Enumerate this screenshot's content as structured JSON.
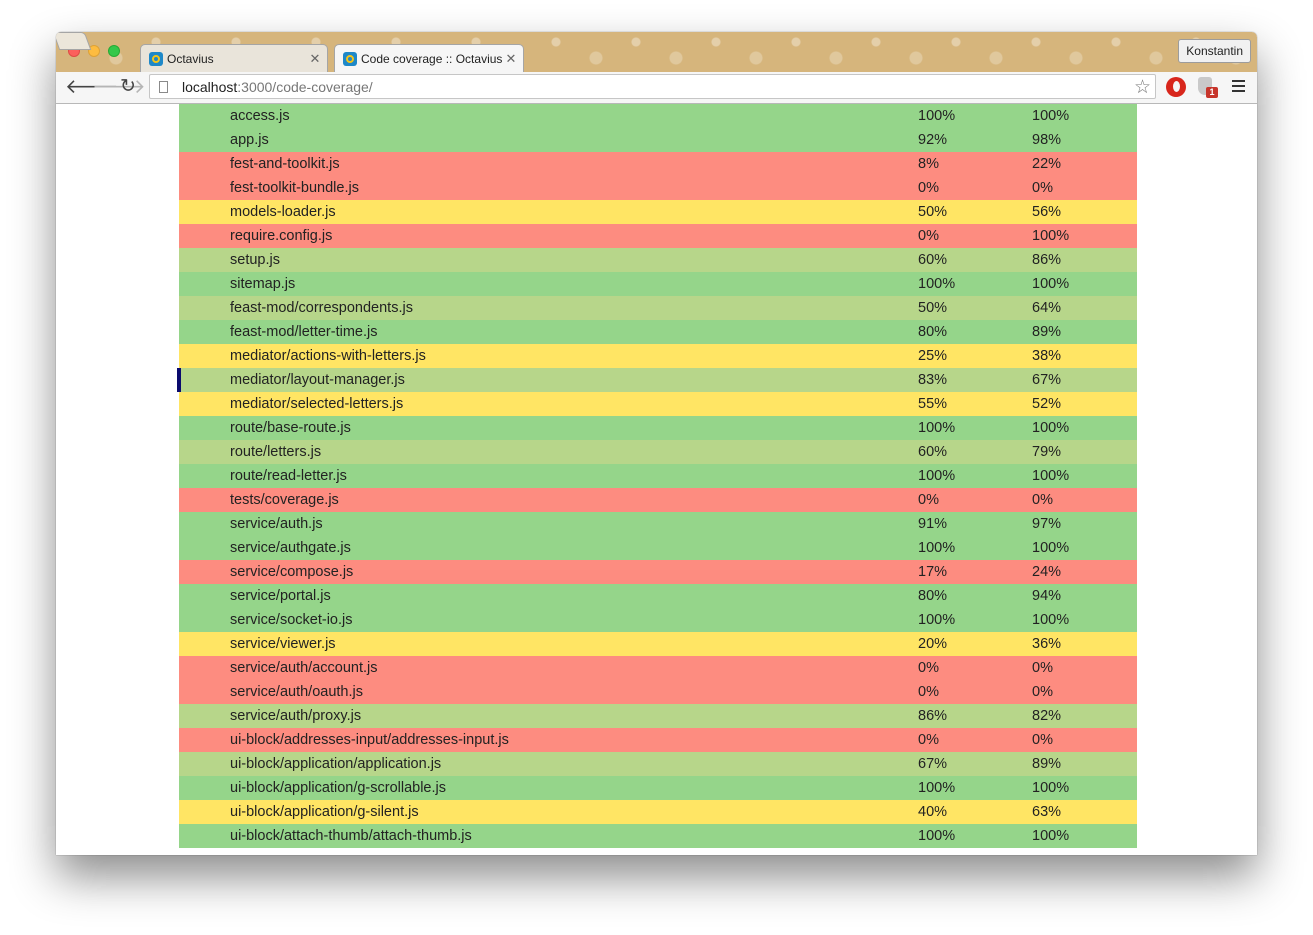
{
  "browser": {
    "tabs": [
      {
        "title": "Octavius",
        "active": false
      },
      {
        "title": "Code coverage :: Octavius",
        "active": true
      }
    ],
    "profile_name": "Konstantin",
    "url_host": "localhost",
    "url_path": ":3000/code-coverage/",
    "extension_badge": "1"
  },
  "colors": {
    "high": "#95d58a",
    "good": "#b7d68a",
    "medium": "#ffe564",
    "low": "#fd8c80"
  },
  "coverage": {
    "rows": [
      {
        "file": "access.js",
        "c1": "100%",
        "c2": "100%",
        "level": "green"
      },
      {
        "file": "app.js",
        "c1": "92%",
        "c2": "98%",
        "level": "green"
      },
      {
        "file": "fest-and-toolkit.js",
        "c1": "8%",
        "c2": "22%",
        "level": "red"
      },
      {
        "file": "fest-toolkit-bundle.js",
        "c1": "0%",
        "c2": "0%",
        "level": "red"
      },
      {
        "file": "models-loader.js",
        "c1": "50%",
        "c2": "56%",
        "level": "yellow"
      },
      {
        "file": "require.config.js",
        "c1": "0%",
        "c2": "100%",
        "level": "red"
      },
      {
        "file": "setup.js",
        "c1": "60%",
        "c2": "86%",
        "level": "lgreen"
      },
      {
        "file": "sitemap.js",
        "c1": "100%",
        "c2": "100%",
        "level": "green"
      },
      {
        "file": "feast-mod/correspondents.js",
        "c1": "50%",
        "c2": "64%",
        "level": "lgreen"
      },
      {
        "file": "feast-mod/letter-time.js",
        "c1": "80%",
        "c2": "89%",
        "level": "green"
      },
      {
        "file": "mediator/actions-with-letters.js",
        "c1": "25%",
        "c2": "38%",
        "level": "yellow"
      },
      {
        "file": "mediator/layout-manager.js",
        "c1": "83%",
        "c2": "67%",
        "level": "lgreen",
        "marked": true
      },
      {
        "file": "mediator/selected-letters.js",
        "c1": "55%",
        "c2": "52%",
        "level": "yellow"
      },
      {
        "file": "route/base-route.js",
        "c1": "100%",
        "c2": "100%",
        "level": "green"
      },
      {
        "file": "route/letters.js",
        "c1": "60%",
        "c2": "79%",
        "level": "lgreen"
      },
      {
        "file": "route/read-letter.js",
        "c1": "100%",
        "c2": "100%",
        "level": "green"
      },
      {
        "file": "tests/coverage.js",
        "c1": "0%",
        "c2": "0%",
        "level": "red"
      },
      {
        "file": "service/auth.js",
        "c1": "91%",
        "c2": "97%",
        "level": "green"
      },
      {
        "file": "service/authgate.js",
        "c1": "100%",
        "c2": "100%",
        "level": "green"
      },
      {
        "file": "service/compose.js",
        "c1": "17%",
        "c2": "24%",
        "level": "red"
      },
      {
        "file": "service/portal.js",
        "c1": "80%",
        "c2": "94%",
        "level": "green"
      },
      {
        "file": "service/socket-io.js",
        "c1": "100%",
        "c2": "100%",
        "level": "green"
      },
      {
        "file": "service/viewer.js",
        "c1": "20%",
        "c2": "36%",
        "level": "yellow"
      },
      {
        "file": "service/auth/account.js",
        "c1": "0%",
        "c2": "0%",
        "level": "red"
      },
      {
        "file": "service/auth/oauth.js",
        "c1": "0%",
        "c2": "0%",
        "level": "red"
      },
      {
        "file": "service/auth/proxy.js",
        "c1": "86%",
        "c2": "82%",
        "level": "lgreen"
      },
      {
        "file": "ui-block/addresses-input/addresses-input.js",
        "c1": "0%",
        "c2": "0%",
        "level": "red"
      },
      {
        "file": "ui-block/application/application.js",
        "c1": "67%",
        "c2": "89%",
        "level": "lgreen"
      },
      {
        "file": "ui-block/application/g-scrollable.js",
        "c1": "100%",
        "c2": "100%",
        "level": "green"
      },
      {
        "file": "ui-block/application/g-silent.js",
        "c1": "40%",
        "c2": "63%",
        "level": "yellow"
      },
      {
        "file": "ui-block/attach-thumb/attach-thumb.js",
        "c1": "100%",
        "c2": "100%",
        "level": "green"
      }
    ]
  }
}
